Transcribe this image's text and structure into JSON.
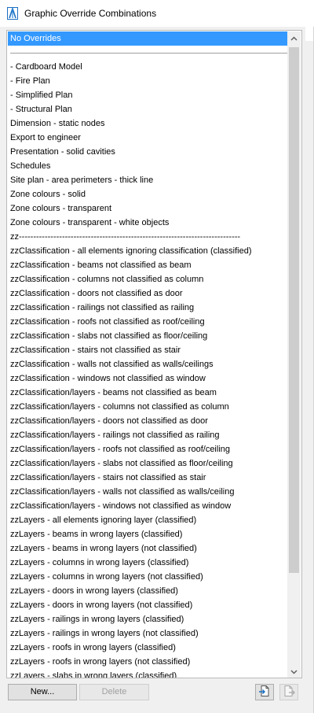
{
  "window": {
    "title": "Graphic Override Combinations"
  },
  "list": {
    "items": [
      {
        "label": "No Overrides",
        "selected": true
      },
      {
        "label": "",
        "separator": true
      },
      {
        "label": "- Cardboard Model"
      },
      {
        "label": "- Fire Plan"
      },
      {
        "label": "- Simplified Plan"
      },
      {
        "label": "- Structural Plan"
      },
      {
        "label": "Dimension - static nodes"
      },
      {
        "label": "Export to engineer"
      },
      {
        "label": "Presentation - solid cavities"
      },
      {
        "label": "Schedules"
      },
      {
        "label": "Site plan - area perimeters - thick line"
      },
      {
        "label": "Zone colours - solid"
      },
      {
        "label": "Zone colours - transparent"
      },
      {
        "label": "Zone colours - transparent - white objects"
      },
      {
        "label": "zz-----------------------------------------------------------------------------"
      },
      {
        "label": "zzClassification - all elements ignoring classification (classified)"
      },
      {
        "label": "zzClassification - beams not classified as beam"
      },
      {
        "label": "zzClassification - columns not classified as column"
      },
      {
        "label": "zzClassification - doors not classified as door"
      },
      {
        "label": "zzClassification - railings not classified as railing"
      },
      {
        "label": "zzClassification - roofs not classified as roof/ceiling"
      },
      {
        "label": "zzClassification - slabs not classified as floor/ceiling"
      },
      {
        "label": "zzClassification - stairs not classified as stair"
      },
      {
        "label": "zzClassification - walls not classified as walls/ceilings"
      },
      {
        "label": "zzClassification - windows not classified as window"
      },
      {
        "label": "zzClassification/layers - beams not classified as beam"
      },
      {
        "label": "zzClassification/layers - columns not classified as column"
      },
      {
        "label": "zzClassification/layers - doors not classified as door"
      },
      {
        "label": "zzClassification/layers - railings not classified as railing"
      },
      {
        "label": "zzClassification/layers - roofs not classified as roof/ceiling"
      },
      {
        "label": "zzClassification/layers - slabs not classified as floor/ceiling"
      },
      {
        "label": "zzClassification/layers - stairs not classified as stair"
      },
      {
        "label": "zzClassification/layers - walls not classified as walls/ceiling"
      },
      {
        "label": "zzClassification/layers - windows not classified as window"
      },
      {
        "label": "zzLayers - all elements ignoring layer (classified)"
      },
      {
        "label": "zzLayers - beams in wrong layers (classified)"
      },
      {
        "label": "zzLayers - beams in wrong layers (not classified)"
      },
      {
        "label": "zzLayers - columns in wrong layers (classified)"
      },
      {
        "label": "zzLayers - columns in wrong layers (not classified)"
      },
      {
        "label": "zzLayers - doors in wrong layers (classified)"
      },
      {
        "label": "zzLayers - doors in wrong layers (not classified)"
      },
      {
        "label": "zzLayers - railings in wrong layers (classified)"
      },
      {
        "label": "zzLayers - railings in wrong layers (not classified)"
      },
      {
        "label": "zzLayers - roofs in wrong layers (classified)"
      },
      {
        "label": "zzLayers - roofs in wrong layers (not classified)"
      },
      {
        "label": "zzLayers - slabs in wrong layers (classified)"
      }
    ]
  },
  "buttons": {
    "new_label": "New...",
    "delete_label": "Delete"
  },
  "icons": {
    "app": "archicad-app-icon",
    "scroll_up": "chevron-up-icon",
    "scroll_down": "chevron-down-icon",
    "import": "import-file-icon",
    "export": "export-file-icon"
  },
  "colors": {
    "selection": "#3399ff",
    "selection_text": "#ffffff",
    "window_bg": "#f0f0f0",
    "list_bg": "#ffffff"
  }
}
